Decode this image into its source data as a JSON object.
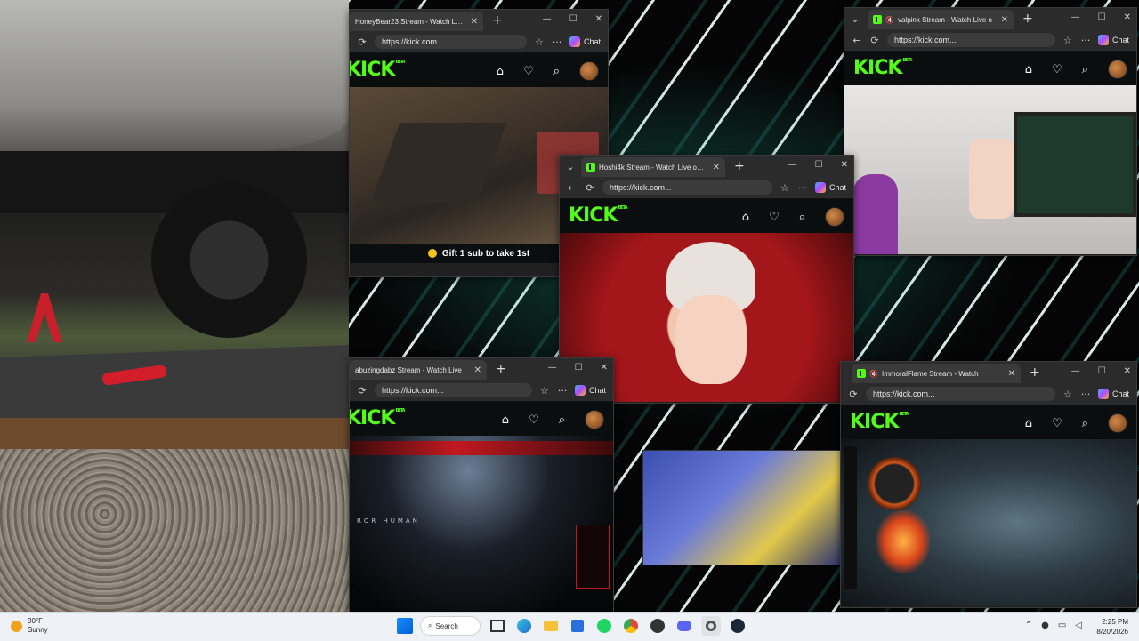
{
  "windows": {
    "honeybear": {
      "tab_title": "HoneyBear23 Stream - Watch Live",
      "url": "https://kick.com...",
      "chat_label": "Chat",
      "banner": "Gift 1 sub to take 1st"
    },
    "valpink": {
      "tab_title": "valpink Stream - Watch Live o",
      "url": "https://kick.com...",
      "chat_label": "Chat"
    },
    "hoshi": {
      "tab_title": "Hoshi4k Stream - Watch Live on K",
      "url": "https://kick.com...",
      "chat_label": "Chat"
    },
    "abuzing": {
      "tab_title": "abuzingdabz Stream - Watch Live",
      "url": "https://kick.com...",
      "chat_label": "Chat",
      "video_text": "ROR HUMAN"
    },
    "immoral": {
      "tab_title": "ImmoralFlame Stream - Watch",
      "url": "https://kick.com...",
      "chat_label": "Chat"
    }
  },
  "kick": {
    "logo": "KICK",
    "beta": "BETA"
  },
  "taskbar": {
    "weather_temp": "90°F",
    "weather_desc": "Sunny",
    "search_label": "Search",
    "time": "2:25 PM",
    "date": "8/20/2026"
  },
  "icons": {
    "back": "←",
    "reload": "⟳",
    "reader": "▤",
    "favorite": "☆",
    "more": "···",
    "minimize": "—",
    "maximize": "☐",
    "close": "✕",
    "new_tab": "+",
    "dropdown": "⌄",
    "mute": "🔇",
    "store": "⌂",
    "heart": "♡",
    "search": "⌕"
  },
  "colors": {
    "kick_green": "#53fc18",
    "browser_dark": "#2b2b2b",
    "taskbar": "#eef1f5"
  }
}
